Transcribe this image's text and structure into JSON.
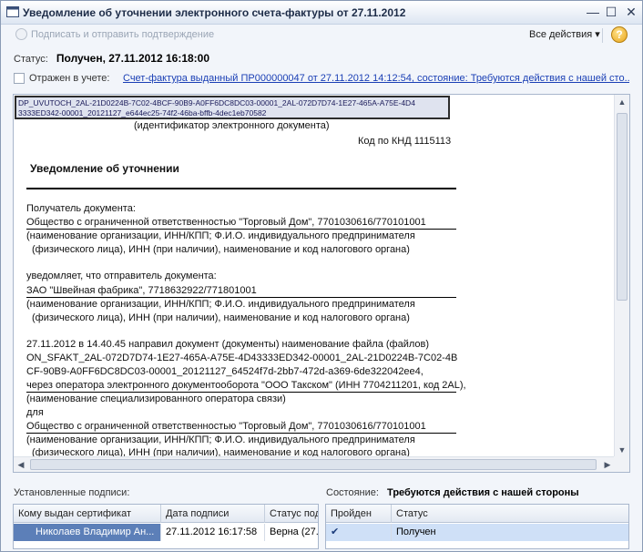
{
  "window": {
    "title": "Уведомление об уточнении электронного счета-фактуры от 27.11.2012",
    "minimize_icon": "minimize-icon",
    "maximize_icon": "maximize-icon",
    "close_icon": "close-icon"
  },
  "toolbar": {
    "sign_label": "Подписать и отправить подтверждение",
    "all_actions_label": "Все действия ▾",
    "help_label": "?"
  },
  "status": {
    "label": "Статус:",
    "value": "Получен, 27.11.2012 16:18:00"
  },
  "reflected": {
    "label": "Отражен в учете:",
    "checked": false,
    "link": "Счет-фактура выданный ПР000000047 от 27.11.2012 14:12:54, состояние: Требуются действия с нашей сто..."
  },
  "document": {
    "id_line1": "DP_UVUTOCH_2AL-21D0224B-7C02-4BCF-90B9-A0FF6DC8DC03-00001_2AL-072D7D74-1E27-465A-A75E-4D4",
    "id_line2": "3333ED342-00001_20121127_e644ec25-74f2-46ba-bffb-4dec1eb70582",
    "id_caption": "(идентификатор электронного документа)",
    "knd": "Код по КНД 1115113",
    "heading": "Уведомление об уточнении",
    "recipient_label": "Получатель документа:",
    "recipient": "Общество с ограниченной ответственностью \"Торговый Дом\", 7701030616/770101001",
    "note_org_1": "(наименование организации, ИНН/КПП; Ф.И.О. индивидуального предпринимателя",
    "note_org_2": "(физического лица), ИНН (при наличии), наименование и код налогового органа)",
    "sender_intro": "уведомляет, что отправитель документа:",
    "sender": "ЗАО \"Швейная фабрика\", 7718632922/771801001",
    "sent_line": "27.11.2012 в 14.40.45 направил документ (документы) наименование файла (файлов)",
    "file_1": "ON_SFAKT_2AL-072D7D74-1E27-465A-A75E-4D43333ED342-00001_2AL-21D0224B-7C02-4B",
    "file_2": "CF-90B9-A0FF6DC8DC03-00001_20121127_64524f7d-2bb7-472d-a369-6de322042ee4,",
    "operator": "через оператора электронного документооборота \"ООО Такском\" (ИНН 7704211201, код 2AL),",
    "operator_note": "(наименование специализированного оператора связи)",
    "for_label": "для",
    "for_org": "Общество с ограниченной ответственностью \"Торговый Дом\", 7701030616/770101001"
  },
  "signatures": {
    "label": "Установленные подписи:",
    "columns": [
      "Кому выдан сертификат",
      "Дата подписи",
      "Статус под"
    ],
    "rows": [
      {
        "holder": "Николаев Владимир Ан...",
        "date": "27.11.2012 16:17:58",
        "status": "Верна (27.1"
      }
    ]
  },
  "state": {
    "label": "Состояние:",
    "value": "Требуются действия с нашей стороны",
    "columns": [
      "Пройден",
      "Статус"
    ],
    "rows": [
      {
        "passed": "✔",
        "status": "Получен"
      }
    ]
  }
}
